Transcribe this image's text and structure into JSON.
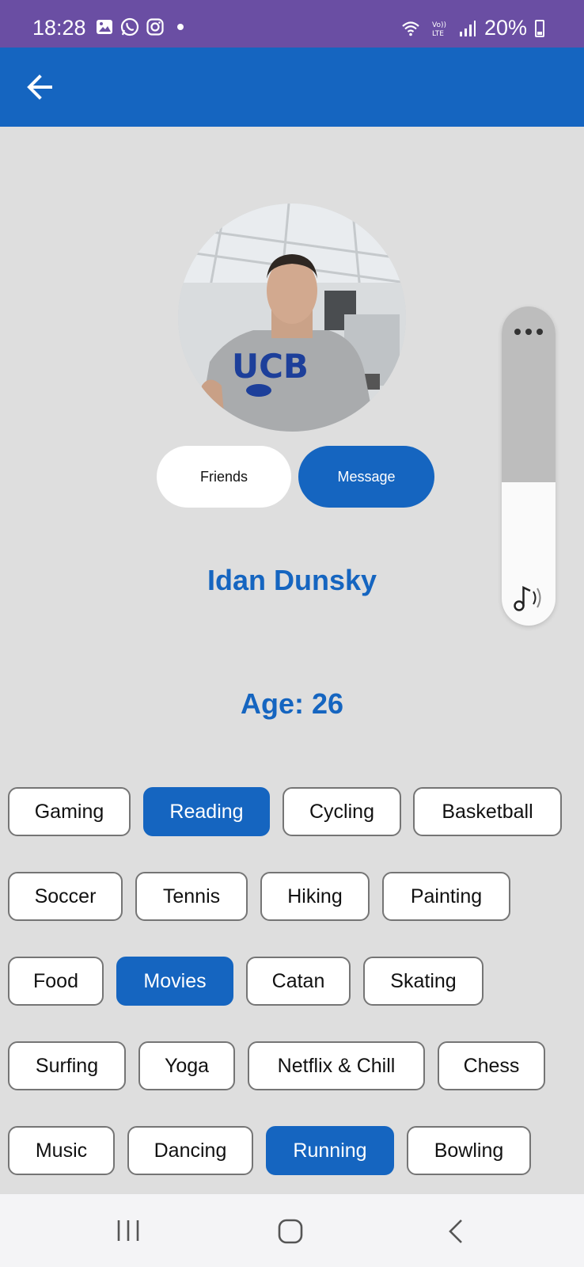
{
  "status_bar": {
    "time": "18:28",
    "battery": "20%"
  },
  "app_bar": {
    "back_icon": "arrow-left-icon"
  },
  "profile": {
    "friends_label": "Friends",
    "message_label": "Message",
    "name": "Idan Dunsky",
    "age_line": "Age: 26"
  },
  "volume_panel": {
    "menu_icon": "more-horizontal-icon",
    "media_icon": "music-note-icon",
    "level_fraction": 0.45
  },
  "interests": [
    {
      "label": "Gaming",
      "selected": false
    },
    {
      "label": "Reading",
      "selected": true
    },
    {
      "label": "Cycling",
      "selected": false
    },
    {
      "label": "Basketball",
      "selected": false
    },
    {
      "label": "Soccer",
      "selected": false
    },
    {
      "label": "Tennis",
      "selected": false
    },
    {
      "label": "Hiking",
      "selected": false
    },
    {
      "label": "Painting",
      "selected": false
    },
    {
      "label": "Food",
      "selected": false
    },
    {
      "label": "Movies",
      "selected": true
    },
    {
      "label": "Catan",
      "selected": false
    },
    {
      "label": "Skating",
      "selected": false
    },
    {
      "label": "Surfing",
      "selected": false
    },
    {
      "label": "Yoga",
      "selected": false
    },
    {
      "label": "Netflix & Chill",
      "selected": false
    },
    {
      "label": "Chess",
      "selected": false
    },
    {
      "label": "Music",
      "selected": false
    },
    {
      "label": "Dancing",
      "selected": false
    },
    {
      "label": "Running",
      "selected": true
    },
    {
      "label": "Bowling",
      "selected": false
    }
  ],
  "colors": {
    "primary": "#1565c0",
    "status_bar": "#6a4ea3",
    "background": "#dedede"
  },
  "nav_bar": {
    "recents_icon": "recents-icon",
    "home_icon": "home-icon",
    "back_icon": "nav-back-icon"
  }
}
